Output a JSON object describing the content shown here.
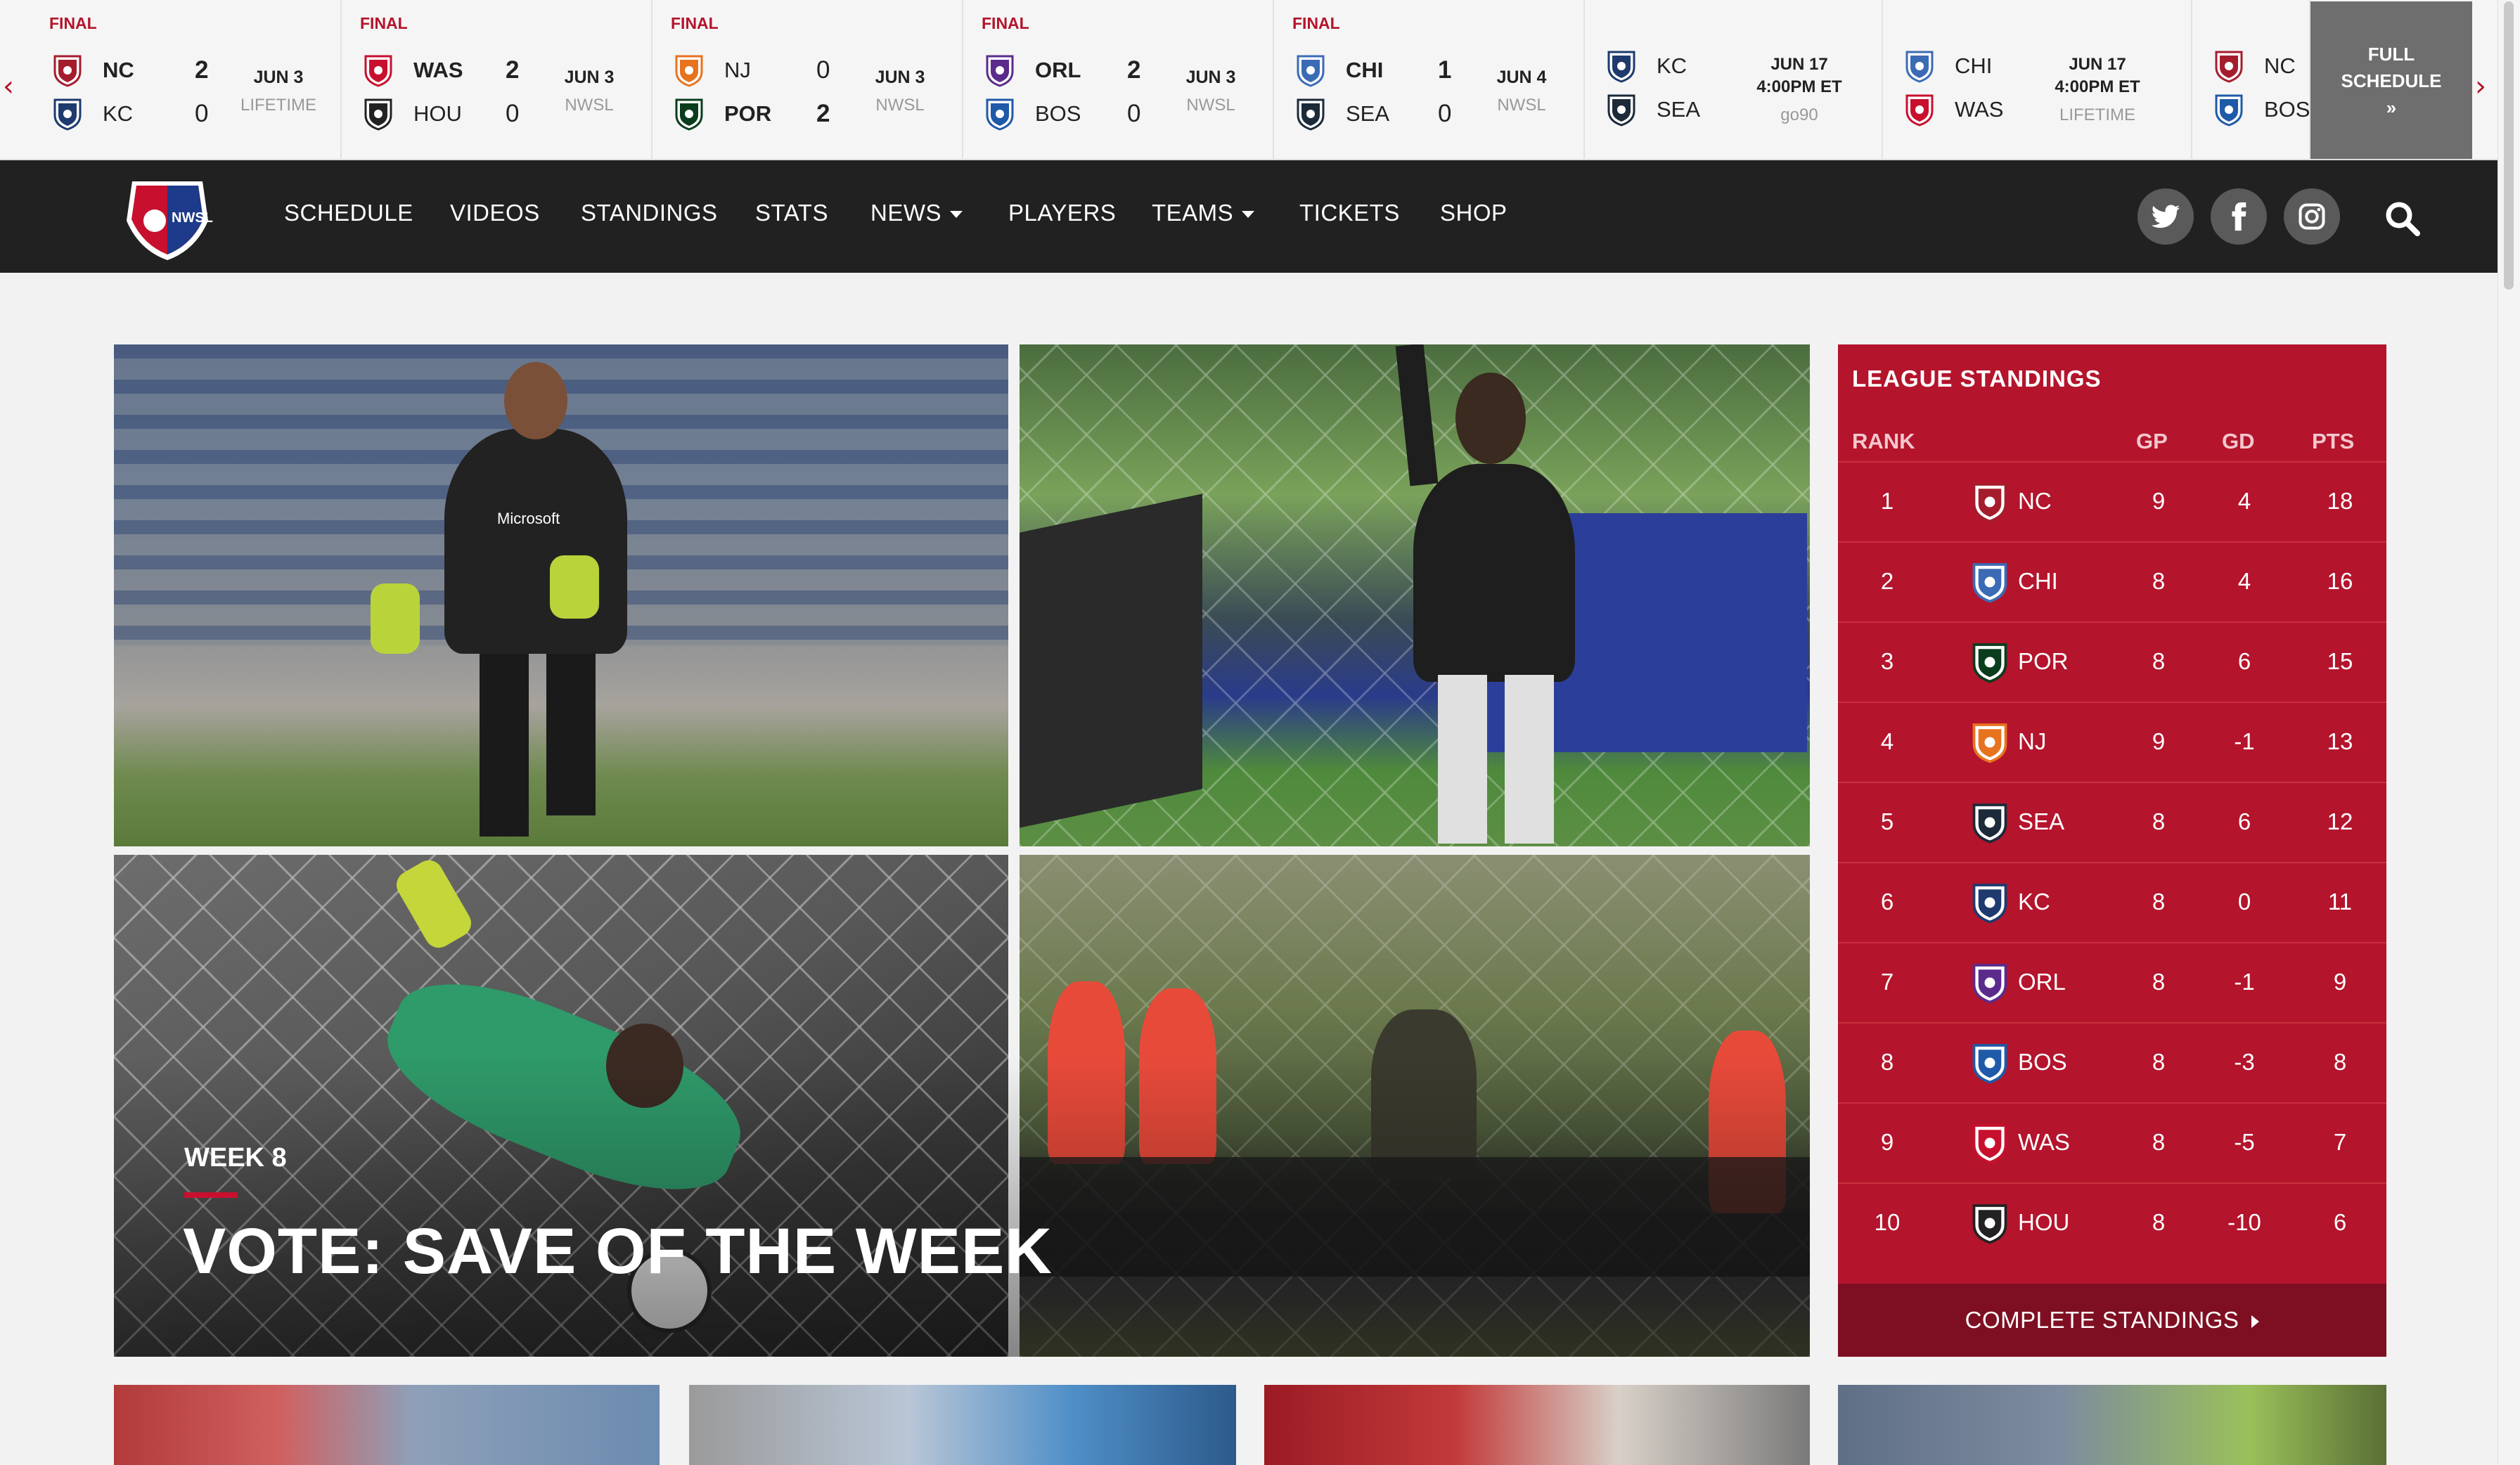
{
  "scorebar": {
    "final_games": [
      {
        "status": "FINAL",
        "home": "NC",
        "home_score": "2",
        "away": "KC",
        "away_score": "0",
        "date": "JUN 3",
        "network": "LIFETIME",
        "winner": "home"
      },
      {
        "status": "FINAL",
        "home": "WAS",
        "home_score": "2",
        "away": "HOU",
        "away_score": "0",
        "date": "JUN 3",
        "network": "NWSL",
        "winner": "home"
      },
      {
        "status": "FINAL",
        "home": "NJ",
        "home_score": "0",
        "away": "POR",
        "away_score": "2",
        "date": "JUN 3",
        "network": "NWSL",
        "winner": "away"
      },
      {
        "status": "FINAL",
        "home": "ORL",
        "home_score": "2",
        "away": "BOS",
        "away_score": "0",
        "date": "JUN 3",
        "network": "NWSL",
        "winner": "home"
      },
      {
        "status": "FINAL",
        "home": "CHI",
        "home_score": "1",
        "away": "SEA",
        "away_score": "0",
        "date": "JUN 4",
        "network": "NWSL",
        "winner": "home"
      }
    ],
    "upcoming_games": [
      {
        "home": "KC",
        "away": "SEA",
        "date": "JUN 17",
        "time": "4:00PM ET",
        "network": "go90"
      },
      {
        "home": "CHI",
        "away": "WAS",
        "date": "JUN 17",
        "time": "4:00PM ET",
        "network": "LIFETIME"
      },
      {
        "home": "NC",
        "away": "BOS",
        "date": "",
        "time": "",
        "network": ""
      }
    ],
    "full_schedule_line1": "FULL",
    "full_schedule_line2": "SCHEDULE",
    "full_schedule_arrow": "»",
    "prev_arrow": "‹",
    "next_arrow": "›"
  },
  "nav": {
    "items": [
      {
        "label": "SCHEDULE",
        "dropdown": false
      },
      {
        "label": "VIDEOS",
        "dropdown": false
      },
      {
        "label": "STANDINGS",
        "dropdown": false
      },
      {
        "label": "STATS",
        "dropdown": false
      },
      {
        "label": "NEWS",
        "dropdown": true
      },
      {
        "label": "PLAYERS",
        "dropdown": false
      },
      {
        "label": "TEAMS",
        "dropdown": true
      },
      {
        "label": "TICKETS",
        "dropdown": false
      },
      {
        "label": "SHOP",
        "dropdown": false
      }
    ],
    "logo_text": "NWSL",
    "social": [
      "twitter-icon",
      "facebook-icon",
      "instagram-icon"
    ],
    "search_icon": "search-icon"
  },
  "hero": {
    "kicker": "WEEK 8",
    "title": "VOTE: SAVE OF THE WEEK",
    "jersey_text": "Microsoft"
  },
  "standings": {
    "title": "LEAGUE STANDINGS",
    "headers": {
      "rank": "RANK",
      "gp": "GP",
      "gd": "GD",
      "pts": "PTS"
    },
    "rows": [
      {
        "rank": "1",
        "team": "NC",
        "gp": "9",
        "gd": "4",
        "pts": "18"
      },
      {
        "rank": "2",
        "team": "CHI",
        "gp": "8",
        "gd": "4",
        "pts": "16"
      },
      {
        "rank": "3",
        "team": "POR",
        "gp": "8",
        "gd": "6",
        "pts": "15"
      },
      {
        "rank": "4",
        "team": "NJ",
        "gp": "9",
        "gd": "-1",
        "pts": "13"
      },
      {
        "rank": "5",
        "team": "SEA",
        "gp": "8",
        "gd": "6",
        "pts": "12"
      },
      {
        "rank": "6",
        "team": "KC",
        "gp": "8",
        "gd": "0",
        "pts": "11"
      },
      {
        "rank": "7",
        "team": "ORL",
        "gp": "8",
        "gd": "-1",
        "pts": "9"
      },
      {
        "rank": "8",
        "team": "BOS",
        "gp": "8",
        "gd": "-3",
        "pts": "8"
      },
      {
        "rank": "9",
        "team": "WAS",
        "gp": "8",
        "gd": "-5",
        "pts": "7"
      },
      {
        "rank": "10",
        "team": "HOU",
        "gp": "8",
        "gd": "-10",
        "pts": "6"
      }
    ],
    "complete_label": "COMPLETE STANDINGS"
  },
  "colors": {
    "accent": "#b4142c",
    "nav_bg": "#212121",
    "standings_dark": "#7e0f22"
  },
  "team_colors": {
    "NC": "#a51d2d",
    "KC": "#1e3a6e",
    "WAS": "#c8102e",
    "HOU": "#222222",
    "NJ": "#e8731f",
    "POR": "#0a3d1d",
    "ORL": "#5b2b8c",
    "BOS": "#1e5aa8",
    "CHI": "#3b6bb5",
    "SEA": "#1c2a3a"
  }
}
